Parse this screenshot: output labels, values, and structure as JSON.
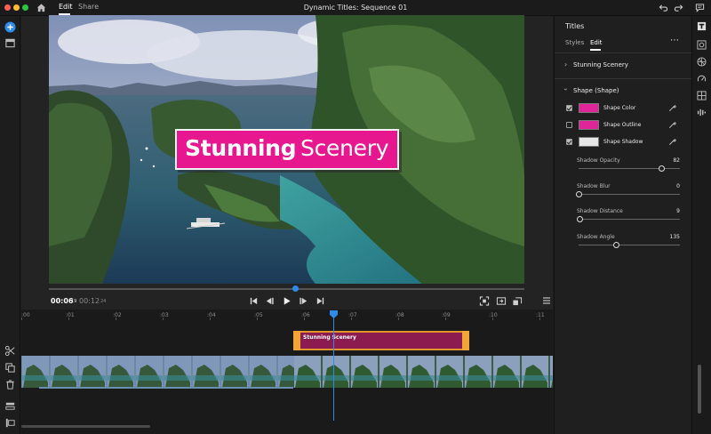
{
  "app": {
    "title": "Dynamic Titles: Sequence 01",
    "tabs": [
      {
        "label": "Edit",
        "active": true
      },
      {
        "label": "Share",
        "active": false
      }
    ]
  },
  "colors": {
    "accent": "#2d8ceb",
    "title_magenta": "#e6178f",
    "title_clip": "#8c1c4f",
    "clip_handle": "#f0a536"
  },
  "viewer": {
    "title_overlay": {
      "word_bold": "Stunning",
      "word_light": "Scenery"
    },
    "timecode_current": "00:06",
    "timecode_current_frames": "19",
    "timecode_total": "00:12",
    "timecode_total_frames": "24",
    "transport_icons": [
      "skip-to-start-icon",
      "step-back-icon",
      "play-icon",
      "step-forward-icon",
      "skip-to-end-icon"
    ],
    "playback_progress": 0.515
  },
  "timeline": {
    "ruler_ticks": [
      ":00",
      ":01",
      ":02",
      ":03",
      ":04",
      ":05",
      ":06",
      ":07",
      ":08",
      ":09",
      ":10",
      ":11"
    ],
    "title_clip_label": "Stunning Scenery"
  },
  "panel": {
    "title": "Titles",
    "tabs": [
      {
        "label": "Styles",
        "active": false
      },
      {
        "label": "Edit",
        "active": true
      }
    ],
    "sections": [
      {
        "label": "Stunning Scenery",
        "expanded": false
      },
      {
        "label": "Shape (Shape)",
        "expanded": true
      }
    ],
    "shape_props": [
      {
        "label": "Shape Color",
        "checked": true,
        "color": "#e0249a"
      },
      {
        "label": "Shape Outline",
        "checked": false,
        "color": "#e0249a"
      },
      {
        "label": "Shape Shadow",
        "checked": true,
        "color": "#e6e6e6"
      }
    ],
    "sliders": [
      {
        "label": "Shadow Opacity",
        "value": "82",
        "fraction": 0.82
      },
      {
        "label": "Shadow Blur",
        "value": "0",
        "fraction": 0.0
      },
      {
        "label": "Shadow Distance",
        "value": "9",
        "fraction": 0.01
      },
      {
        "label": "Shadow Angle",
        "value": "135",
        "fraction": 0.37
      }
    ]
  }
}
